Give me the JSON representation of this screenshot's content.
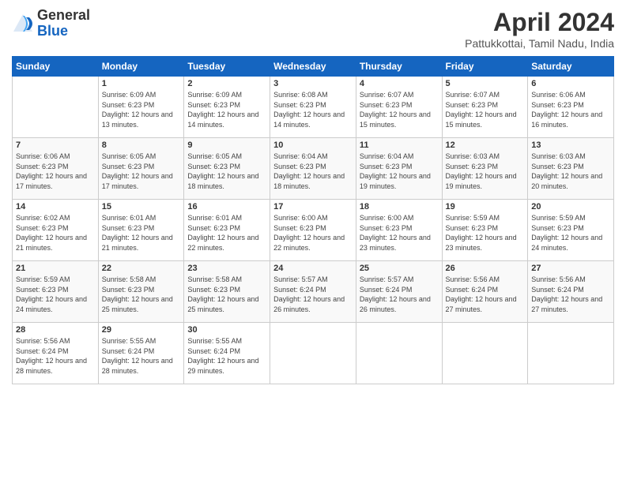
{
  "header": {
    "logo_general": "General",
    "logo_blue": "Blue",
    "title": "April 2024",
    "location": "Pattukkottai, Tamil Nadu, India"
  },
  "days_of_week": [
    "Sunday",
    "Monday",
    "Tuesday",
    "Wednesday",
    "Thursday",
    "Friday",
    "Saturday"
  ],
  "weeks": [
    [
      {
        "num": "",
        "detail": ""
      },
      {
        "num": "1",
        "detail": "Sunrise: 6:09 AM\nSunset: 6:23 PM\nDaylight: 12 hours\nand 13 minutes."
      },
      {
        "num": "2",
        "detail": "Sunrise: 6:09 AM\nSunset: 6:23 PM\nDaylight: 12 hours\nand 14 minutes."
      },
      {
        "num": "3",
        "detail": "Sunrise: 6:08 AM\nSunset: 6:23 PM\nDaylight: 12 hours\nand 14 minutes."
      },
      {
        "num": "4",
        "detail": "Sunrise: 6:07 AM\nSunset: 6:23 PM\nDaylight: 12 hours\nand 15 minutes."
      },
      {
        "num": "5",
        "detail": "Sunrise: 6:07 AM\nSunset: 6:23 PM\nDaylight: 12 hours\nand 15 minutes."
      },
      {
        "num": "6",
        "detail": "Sunrise: 6:06 AM\nSunset: 6:23 PM\nDaylight: 12 hours\nand 16 minutes."
      }
    ],
    [
      {
        "num": "7",
        "detail": "Sunrise: 6:06 AM\nSunset: 6:23 PM\nDaylight: 12 hours\nand 17 minutes."
      },
      {
        "num": "8",
        "detail": "Sunrise: 6:05 AM\nSunset: 6:23 PM\nDaylight: 12 hours\nand 17 minutes."
      },
      {
        "num": "9",
        "detail": "Sunrise: 6:05 AM\nSunset: 6:23 PM\nDaylight: 12 hours\nand 18 minutes."
      },
      {
        "num": "10",
        "detail": "Sunrise: 6:04 AM\nSunset: 6:23 PM\nDaylight: 12 hours\nand 18 minutes."
      },
      {
        "num": "11",
        "detail": "Sunrise: 6:04 AM\nSunset: 6:23 PM\nDaylight: 12 hours\nand 19 minutes."
      },
      {
        "num": "12",
        "detail": "Sunrise: 6:03 AM\nSunset: 6:23 PM\nDaylight: 12 hours\nand 19 minutes."
      },
      {
        "num": "13",
        "detail": "Sunrise: 6:03 AM\nSunset: 6:23 PM\nDaylight: 12 hours\nand 20 minutes."
      }
    ],
    [
      {
        "num": "14",
        "detail": "Sunrise: 6:02 AM\nSunset: 6:23 PM\nDaylight: 12 hours\nand 21 minutes."
      },
      {
        "num": "15",
        "detail": "Sunrise: 6:01 AM\nSunset: 6:23 PM\nDaylight: 12 hours\nand 21 minutes."
      },
      {
        "num": "16",
        "detail": "Sunrise: 6:01 AM\nSunset: 6:23 PM\nDaylight: 12 hours\nand 22 minutes."
      },
      {
        "num": "17",
        "detail": "Sunrise: 6:00 AM\nSunset: 6:23 PM\nDaylight: 12 hours\nand 22 minutes."
      },
      {
        "num": "18",
        "detail": "Sunrise: 6:00 AM\nSunset: 6:23 PM\nDaylight: 12 hours\nand 23 minutes."
      },
      {
        "num": "19",
        "detail": "Sunrise: 5:59 AM\nSunset: 6:23 PM\nDaylight: 12 hours\nand 23 minutes."
      },
      {
        "num": "20",
        "detail": "Sunrise: 5:59 AM\nSunset: 6:23 PM\nDaylight: 12 hours\nand 24 minutes."
      }
    ],
    [
      {
        "num": "21",
        "detail": "Sunrise: 5:59 AM\nSunset: 6:23 PM\nDaylight: 12 hours\nand 24 minutes."
      },
      {
        "num": "22",
        "detail": "Sunrise: 5:58 AM\nSunset: 6:23 PM\nDaylight: 12 hours\nand 25 minutes."
      },
      {
        "num": "23",
        "detail": "Sunrise: 5:58 AM\nSunset: 6:23 PM\nDaylight: 12 hours\nand 25 minutes."
      },
      {
        "num": "24",
        "detail": "Sunrise: 5:57 AM\nSunset: 6:24 PM\nDaylight: 12 hours\nand 26 minutes."
      },
      {
        "num": "25",
        "detail": "Sunrise: 5:57 AM\nSunset: 6:24 PM\nDaylight: 12 hours\nand 26 minutes."
      },
      {
        "num": "26",
        "detail": "Sunrise: 5:56 AM\nSunset: 6:24 PM\nDaylight: 12 hours\nand 27 minutes."
      },
      {
        "num": "27",
        "detail": "Sunrise: 5:56 AM\nSunset: 6:24 PM\nDaylight: 12 hours\nand 27 minutes."
      }
    ],
    [
      {
        "num": "28",
        "detail": "Sunrise: 5:56 AM\nSunset: 6:24 PM\nDaylight: 12 hours\nand 28 minutes."
      },
      {
        "num": "29",
        "detail": "Sunrise: 5:55 AM\nSunset: 6:24 PM\nDaylight: 12 hours\nand 28 minutes."
      },
      {
        "num": "30",
        "detail": "Sunrise: 5:55 AM\nSunset: 6:24 PM\nDaylight: 12 hours\nand 29 minutes."
      },
      {
        "num": "",
        "detail": ""
      },
      {
        "num": "",
        "detail": ""
      },
      {
        "num": "",
        "detail": ""
      },
      {
        "num": "",
        "detail": ""
      }
    ]
  ]
}
